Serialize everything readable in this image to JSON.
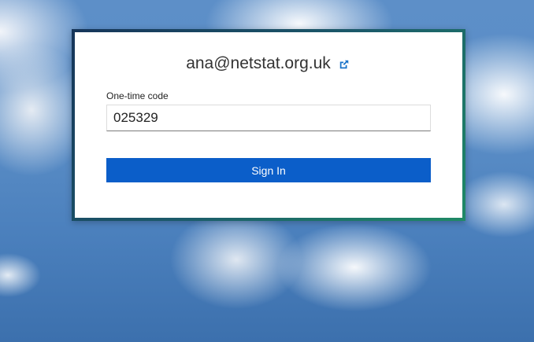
{
  "user": {
    "email": "ana@netstat.org.uk",
    "switch_icon": "external-share-icon"
  },
  "form": {
    "code_label": "One-time code",
    "code_value": "025329",
    "submit_label": "Sign In"
  },
  "colors": {
    "button": "#0b5ec9",
    "frame_start": "#16355a",
    "frame_end": "#1f8a66",
    "icon": "#1a73c9"
  }
}
